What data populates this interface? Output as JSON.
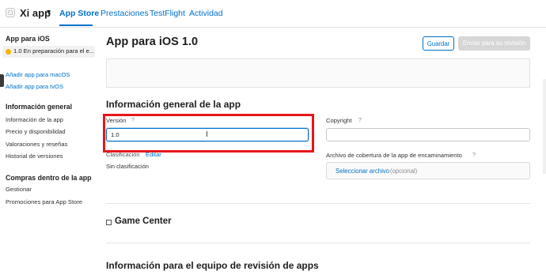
{
  "header": {
    "app_name": "Xi app",
    "chevron": "▾",
    "tabs": [
      {
        "label": "App Store",
        "active": true
      },
      {
        "label": "Prestaciones",
        "active": false
      },
      {
        "label": "TestFlight",
        "active": false
      },
      {
        "label": "Actividad",
        "active": false
      }
    ]
  },
  "sidebar": {
    "platform_heading": "App para iOS",
    "version_status": "1.0 En preparación para el e...",
    "status_color": "#f5b400",
    "add_macos": "Añadir app para macOS",
    "add_tvos": "Añadir app para tvOS",
    "general_heading": "Información general",
    "general_items": [
      "Información de la app",
      "Precio y disponibilidad",
      "Valoraciones y reseñas",
      "Historial de versiones"
    ],
    "iap_heading": "Compras dentro de la app",
    "iap_items": [
      "Gestionar",
      "Promociones para App Store"
    ]
  },
  "main": {
    "title": "App para iOS 1.0",
    "save_label": "Guardar",
    "submit_label": "Enviar para su revisión",
    "general_section_title": "Información general de la app",
    "version_label": "Versión",
    "version_help": "?",
    "version_value": "1.0",
    "copyright_label": "Copyright",
    "copyright_help": "?",
    "copyright_value": "",
    "rating_label": "Clasificación",
    "rating_edit": "Editar",
    "rating_value": "Sin clasificación",
    "routing_label": "Archivo de cobertura de la app de encaminamiento",
    "routing_help": "?",
    "choose_file": "Seleccionar archivo",
    "optional": "(opcional)",
    "game_center_title": "Game Center",
    "review_section_title": "Información para el equipo de revisión de apps"
  },
  "colors": {
    "accent": "#0070c9",
    "highlight": "#e8161a"
  }
}
